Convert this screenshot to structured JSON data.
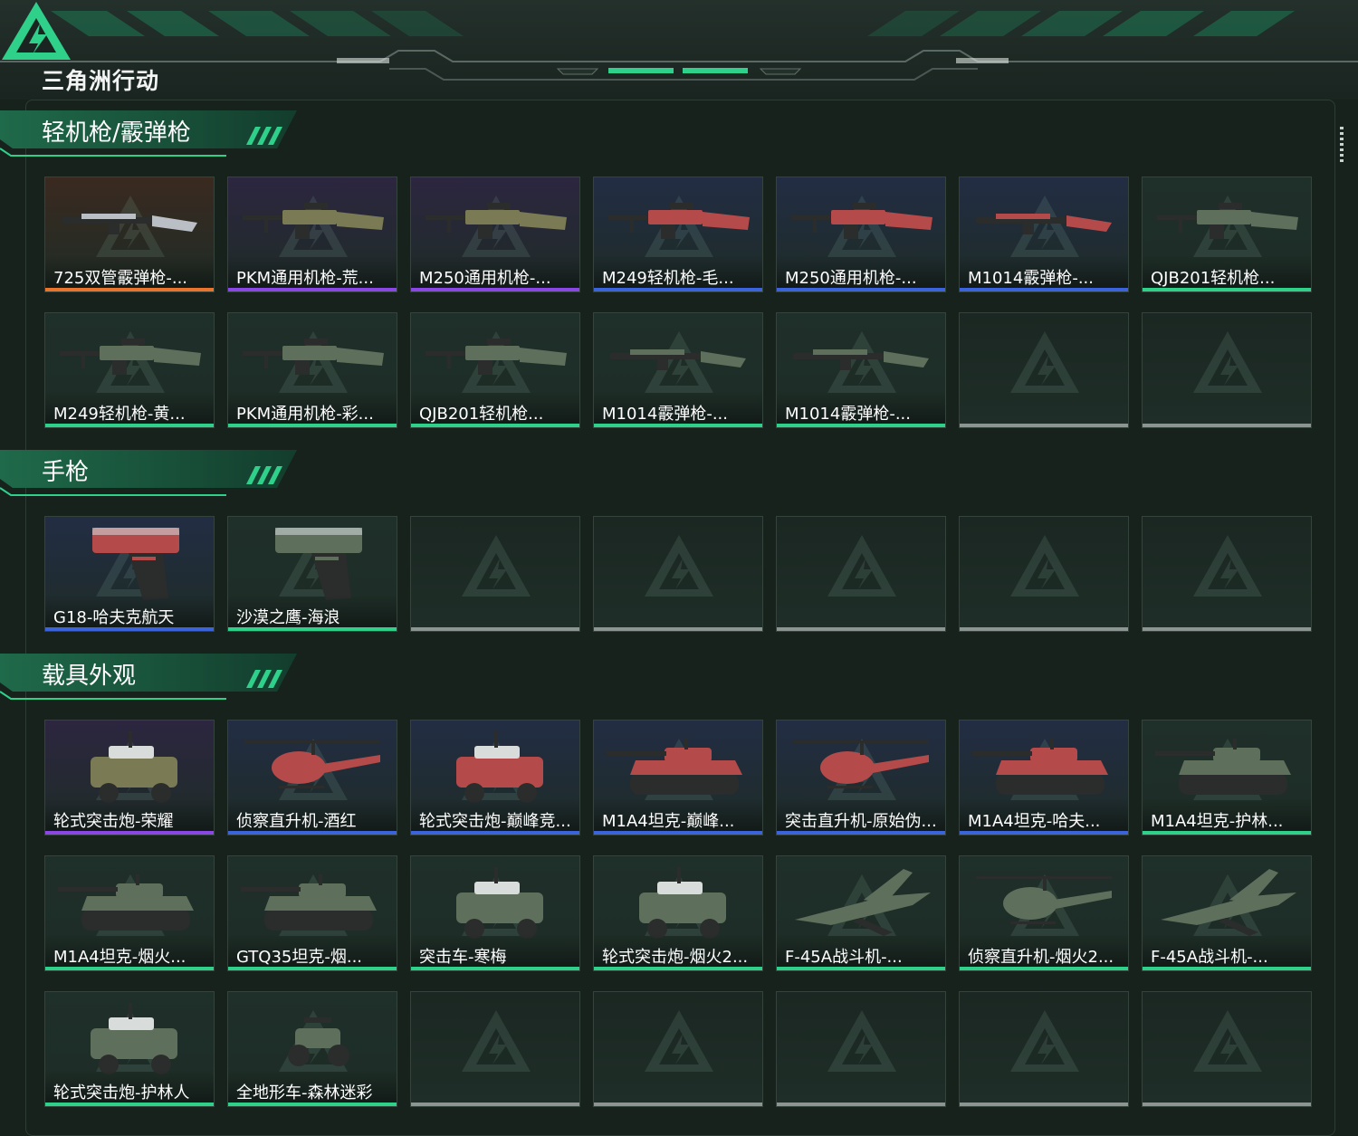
{
  "app": {
    "logo_text": "三角洲行动",
    "accent_color": "#2fd08a"
  },
  "rarity_colors": {
    "orange": "#e8742e",
    "purple": "#8a47e6",
    "blue": "#3a63dc",
    "green": "#2fd08a",
    "gray": "#8d9592"
  },
  "sections": [
    {
      "title": "轻机枪/霰弹枪",
      "items": [
        {
          "name": "725双管霰弹枪-...",
          "rarity": "orange",
          "icon": "shotgun-icon",
          "bg": "#3a2a20"
        },
        {
          "name": "PKM通用机枪-荒...",
          "rarity": "purple",
          "icon": "machine-gun-icon",
          "bg": "#2c2640"
        },
        {
          "name": "M250通用机枪-...",
          "rarity": "purple",
          "icon": "machine-gun-icon",
          "bg": "#2c2640"
        },
        {
          "name": "M249轻机枪-毛...",
          "rarity": "blue",
          "icon": "machine-gun-icon",
          "bg": "#222d44"
        },
        {
          "name": "M250通用机枪-...",
          "rarity": "blue",
          "icon": "machine-gun-icon",
          "bg": "#222d44"
        },
        {
          "name": "M1014霰弹枪-...",
          "rarity": "blue",
          "icon": "shotgun-icon",
          "bg": "#222d44"
        },
        {
          "name": "QJB201轻机枪...",
          "rarity": "green",
          "icon": "machine-gun-icon",
          "bg": "#1f2f29"
        },
        {
          "name": "M249轻机枪-黄...",
          "rarity": "green",
          "icon": "machine-gun-icon",
          "bg": "#1f2f29"
        },
        {
          "name": "PKM通用机枪-彩...",
          "rarity": "green",
          "icon": "machine-gun-icon",
          "bg": "#1f2f29"
        },
        {
          "name": "QJB201轻机枪...",
          "rarity": "green",
          "icon": "machine-gun-icon",
          "bg": "#1f2f29"
        },
        {
          "name": "M1014霰弹枪-...",
          "rarity": "green",
          "icon": "shotgun-icon",
          "bg": "#1f2f29"
        },
        {
          "name": "M1014霰弹枪-...",
          "rarity": "green",
          "icon": "shotgun-icon",
          "bg": "#1f2f29"
        },
        {
          "name": "",
          "rarity": "gray",
          "icon": "",
          "bg": ""
        },
        {
          "name": "",
          "rarity": "gray",
          "icon": "",
          "bg": ""
        }
      ]
    },
    {
      "title": "手枪",
      "items": [
        {
          "name": "G18-哈夫克航天",
          "rarity": "blue",
          "icon": "pistol-icon",
          "bg": "#222d44"
        },
        {
          "name": "沙漠之鹰-海浪",
          "rarity": "green",
          "icon": "pistol-icon",
          "bg": "#1f2f29"
        },
        {
          "name": "",
          "rarity": "gray",
          "icon": "",
          "bg": ""
        },
        {
          "name": "",
          "rarity": "gray",
          "icon": "",
          "bg": ""
        },
        {
          "name": "",
          "rarity": "gray",
          "icon": "",
          "bg": ""
        },
        {
          "name": "",
          "rarity": "gray",
          "icon": "",
          "bg": ""
        },
        {
          "name": "",
          "rarity": "gray",
          "icon": "",
          "bg": ""
        }
      ]
    },
    {
      "title": "载具外观",
      "items": [
        {
          "name": "轮式突击炮-荣耀",
          "rarity": "purple",
          "icon": "armored-car-icon",
          "bg": "#2c2640"
        },
        {
          "name": "侦察直升机-酒红",
          "rarity": "blue",
          "icon": "helicopter-icon",
          "bg": "#222d44"
        },
        {
          "name": "轮式突击炮-巅峰竞...",
          "rarity": "blue",
          "icon": "armored-car-icon",
          "bg": "#222d44"
        },
        {
          "name": "M1A4坦克-巅峰...",
          "rarity": "blue",
          "icon": "tank-icon",
          "bg": "#222d44"
        },
        {
          "name": "突击直升机-原始伪...",
          "rarity": "blue",
          "icon": "helicopter-icon",
          "bg": "#222d44"
        },
        {
          "name": "M1A4坦克-哈夫...",
          "rarity": "blue",
          "icon": "tank-icon",
          "bg": "#222d44"
        },
        {
          "name": "M1A4坦克-护林...",
          "rarity": "green",
          "icon": "tank-icon",
          "bg": "#1f2f29"
        },
        {
          "name": "M1A4坦克-烟火...",
          "rarity": "green",
          "icon": "tank-icon",
          "bg": "#1f2f29"
        },
        {
          "name": "GTQ35坦克-烟...",
          "rarity": "green",
          "icon": "tank-icon",
          "bg": "#1f2f29"
        },
        {
          "name": "突击车-寒梅",
          "rarity": "green",
          "icon": "armored-car-icon",
          "bg": "#1f2f29"
        },
        {
          "name": "轮式突击炮-烟火2...",
          "rarity": "green",
          "icon": "armored-car-icon",
          "bg": "#1f2f29"
        },
        {
          "name": "F-45A战斗机-...",
          "rarity": "green",
          "icon": "jet-icon",
          "bg": "#1f2f29"
        },
        {
          "name": "侦察直升机-烟火2...",
          "rarity": "green",
          "icon": "helicopter-icon",
          "bg": "#1f2f29"
        },
        {
          "name": "F-45A战斗机-...",
          "rarity": "green",
          "icon": "jet-icon",
          "bg": "#1f2f29"
        },
        {
          "name": "轮式突击炮-护林人",
          "rarity": "green",
          "icon": "armored-car-icon",
          "bg": "#1f2f29"
        },
        {
          "name": "全地形车-森林迷彩",
          "rarity": "green",
          "icon": "atv-icon",
          "bg": "#1f2f29"
        },
        {
          "name": "",
          "rarity": "gray",
          "icon": "",
          "bg": ""
        },
        {
          "name": "",
          "rarity": "gray",
          "icon": "",
          "bg": ""
        },
        {
          "name": "",
          "rarity": "gray",
          "icon": "",
          "bg": ""
        },
        {
          "name": "",
          "rarity": "gray",
          "icon": "",
          "bg": ""
        },
        {
          "name": "",
          "rarity": "gray",
          "icon": "",
          "bg": ""
        }
      ]
    }
  ]
}
